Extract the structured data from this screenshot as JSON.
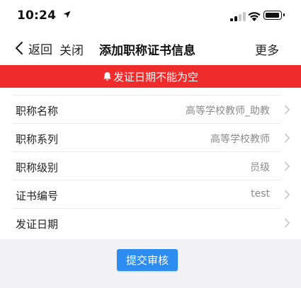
{
  "status_bar": {
    "time": "10:24",
    "icons": [
      "location-arrow-icon",
      "cellular-signal-icon",
      "wifi-icon",
      "battery-icon"
    ]
  },
  "nav": {
    "back_label": "返回",
    "close_label": "关闭",
    "title": "添加职称证书信息",
    "more_label": "更多"
  },
  "error_banner": {
    "icon": "bell-icon",
    "message": "发证日期不能为空",
    "color": "#ee2c2c"
  },
  "form": {
    "rows": [
      {
        "label": "职称名称",
        "value": "高等学校教师_助教"
      },
      {
        "label": "职称系列",
        "value": "高等学校教师"
      },
      {
        "label": "职称级别",
        "value": "员级"
      },
      {
        "label": "证书编号",
        "value": "test"
      },
      {
        "label": "发证日期",
        "value": ""
      }
    ]
  },
  "submit": {
    "label": "提交审核",
    "color": "#2d8cf0"
  }
}
